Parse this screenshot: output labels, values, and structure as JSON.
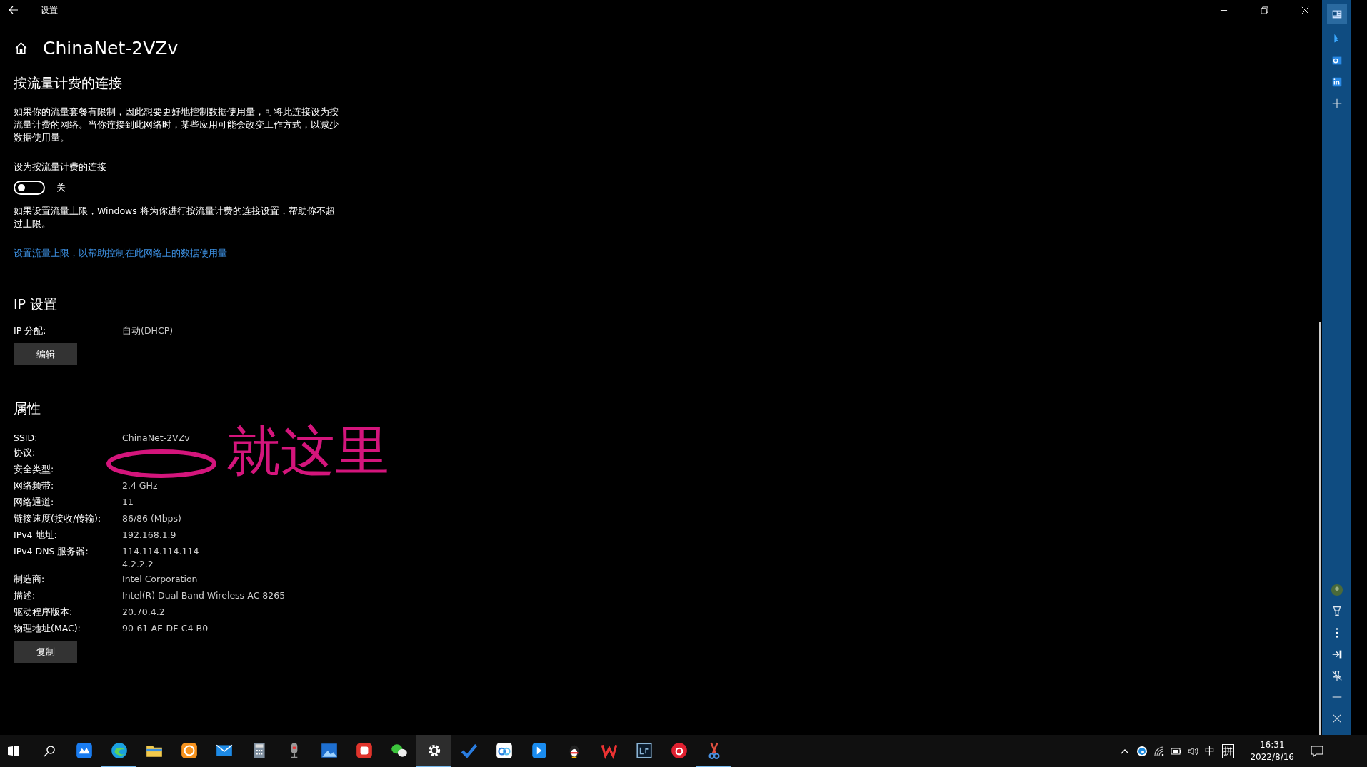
{
  "window": {
    "title": "设置"
  },
  "page": {
    "title": "ChinaNet-2VZv"
  },
  "metered": {
    "heading": "按流量计费的连接",
    "description": "如果你的流量套餐有限制，因此想要更好地控制数据使用量，可将此连接设为按流量计费的网络。当你连接到此网络时，某些应用可能会改变工作方式，以减少数据使用量。",
    "toggle": {
      "label": "设为按流量计费的连接",
      "on": false,
      "state_text": "关"
    },
    "note": "如果设置流量上限，Windows 将为你进行按流量计费的连接设置，帮助你不超过上限。",
    "link": "设置流量上限，以帮助控制在此网络上的数据使用量"
  },
  "ip_settings": {
    "heading": "IP 设置",
    "rows": [
      {
        "label": "IP 分配:",
        "values": [
          "自动(DHCP)"
        ]
      }
    ],
    "button": "编辑"
  },
  "properties": {
    "heading": "属性",
    "rows": [
      {
        "label": "SSID:",
        "values": [
          "ChinaNet-2VZv"
        ]
      },
      {
        "label": "协议:"
      },
      {
        "label": "安全类型:"
      },
      {
        "label": "网络频带:",
        "values": [
          "2.4 GHz"
        ]
      },
      {
        "label": "网络通道:",
        "values": [
          "11"
        ]
      },
      {
        "label": "链接速度(接收/传输):",
        "values": [
          "86/86 (Mbps)"
        ]
      },
      {
        "label": "IPv4 地址:",
        "values": [
          "192.168.1.9"
        ]
      },
      {
        "label": "IPv4 DNS 服务器:",
        "values": [
          "114.114.114.114",
          "4.2.2.2"
        ]
      },
      {
        "label": "制造商:",
        "values": [
          "Intel Corporation"
        ]
      },
      {
        "label": "描述:",
        "values": [
          "Intel(R) Dual Band Wireless-AC 8265"
        ]
      },
      {
        "label": "驱动程序版本:",
        "values": [
          "20.70.4.2"
        ]
      },
      {
        "label": "物理地址(MAC):",
        "values": [
          "90-61-AE-DF-C4-B0"
        ]
      }
    ],
    "button": "复制"
  },
  "annotation": {
    "text": "就这里"
  },
  "taskbar": {
    "apps": [
      {
        "running": false,
        "selected": false
      },
      {
        "running": true,
        "selected": false
      },
      {
        "running": false,
        "selected": false
      },
      {
        "running": false,
        "selected": false
      },
      {
        "running": false,
        "selected": false
      },
      {
        "running": false,
        "selected": false
      },
      {
        "running": false,
        "selected": false
      },
      {
        "running": false,
        "selected": false
      },
      {
        "running": false,
        "selected": false
      },
      {
        "running": false,
        "selected": false
      },
      {
        "running": true,
        "selected": true
      },
      {
        "running": false,
        "selected": false
      },
      {
        "running": false,
        "selected": false
      },
      {
        "running": false,
        "selected": false
      },
      {
        "running": false,
        "selected": false
      },
      {
        "running": false,
        "selected": false
      },
      {
        "running": false,
        "selected": false
      },
      {
        "running": false,
        "selected": false
      },
      {
        "running": true,
        "selected": false
      }
    ],
    "tray": {
      "ime_mode": "中",
      "ime": "拼",
      "time": "16:31",
      "date": "2022/8/16"
    }
  }
}
